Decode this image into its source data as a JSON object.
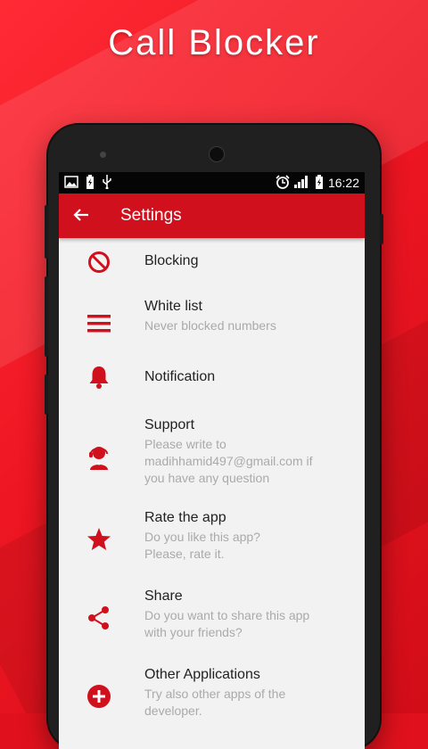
{
  "promo": {
    "title": "Call Blocker"
  },
  "status_bar": {
    "time": "16:22"
  },
  "app_bar": {
    "title": "Settings"
  },
  "colors": {
    "accent": "#d0101c",
    "background_red": "#e0111c"
  },
  "settings": [
    {
      "title": "Blocking",
      "subtitle": "",
      "icon": "block-icon"
    },
    {
      "title": "White list",
      "subtitle": "Never blocked numbers",
      "icon": "list-icon"
    },
    {
      "title": "Notification",
      "subtitle": "",
      "icon": "bell-icon"
    },
    {
      "title": "Support",
      "subtitle_lines": [
        "Please write to",
        "madihhamid497@gmail.com if",
        "you have any question"
      ],
      "icon": "headset-icon"
    },
    {
      "title": "Rate the app",
      "subtitle_lines": [
        "Do you like this app?",
        "Please, rate it."
      ],
      "icon": "star-icon"
    },
    {
      "title": "Share",
      "subtitle_lines": [
        "Do you want to share this app",
        "with your friends?"
      ],
      "icon": "share-icon"
    },
    {
      "title": "Other Applications",
      "subtitle_lines": [
        "Try also other apps of the",
        "developer."
      ],
      "icon": "plus-circle-icon"
    }
  ]
}
